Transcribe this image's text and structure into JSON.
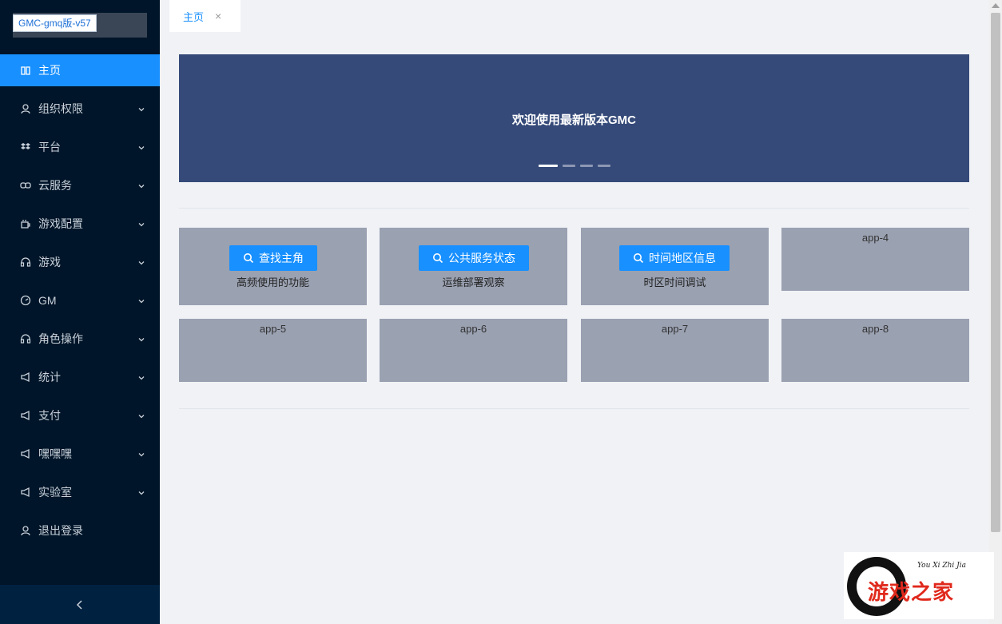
{
  "app": {
    "logo_label": "GMC-gmq版-v57"
  },
  "sidebar": {
    "items": [
      {
        "label": "主页",
        "icon": "home-icon",
        "active": true,
        "has_children": false
      },
      {
        "label": "组织权限",
        "icon": "user-icon",
        "active": false,
        "has_children": true
      },
      {
        "label": "平台",
        "icon": "dropbox-icon",
        "active": false,
        "has_children": true
      },
      {
        "label": "云服务",
        "icon": "link-icon",
        "active": false,
        "has_children": true
      },
      {
        "label": "游戏配置",
        "icon": "coffee-icon",
        "active": false,
        "has_children": true
      },
      {
        "label": "游戏",
        "icon": "headset-icon",
        "active": false,
        "has_children": true
      },
      {
        "label": "GM",
        "icon": "dashboard-icon",
        "active": false,
        "has_children": true
      },
      {
        "label": "角色操作",
        "icon": "headset-icon",
        "active": false,
        "has_children": true
      },
      {
        "label": "统计",
        "icon": "notification-icon",
        "active": false,
        "has_children": true
      },
      {
        "label": "支付",
        "icon": "notification-icon",
        "active": false,
        "has_children": true
      },
      {
        "label": "嘿嘿嘿",
        "icon": "notification-icon",
        "active": false,
        "has_children": true
      },
      {
        "label": "实验室",
        "icon": "notification-icon",
        "active": false,
        "has_children": true
      },
      {
        "label": "退出登录",
        "icon": "user-icon",
        "active": false,
        "has_children": false
      }
    ],
    "collapse_icon": "chevron-left-icon"
  },
  "tabs": [
    {
      "label": "主页",
      "close": "×"
    }
  ],
  "banner": {
    "title": "欢迎使用最新版本GMC",
    "slides": 4,
    "active_slide": 0,
    "background": "#354a79"
  },
  "cards": [
    {
      "button": "查找主角",
      "desc": "高频使用的功能"
    },
    {
      "button": "公共服务状态",
      "desc": "运维部署观察"
    },
    {
      "button": "时间地区信息",
      "desc": "时区时间调试"
    },
    {
      "label": "app-4"
    },
    {
      "label": "app-5"
    },
    {
      "label": "app-6"
    },
    {
      "label": "app-7"
    },
    {
      "label": "app-8"
    }
  ],
  "watermark": {
    "text": "游戏之家",
    "sub": "You Xi Zhi Jia"
  },
  "colors": {
    "primary": "#1890ff",
    "sidebar": "#001529",
    "card": "#9aa1b1"
  }
}
